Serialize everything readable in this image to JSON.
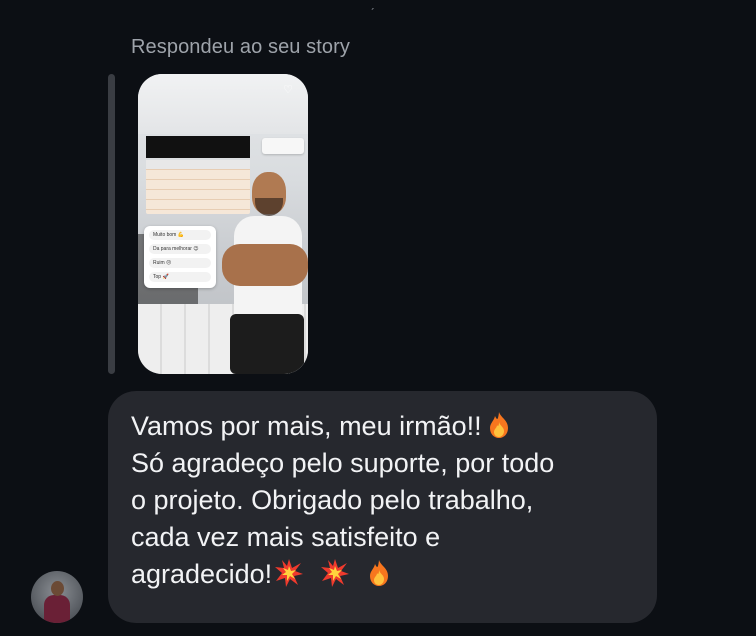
{
  "thread": {
    "reply_caption": "Respondeu ao seu story",
    "message": {
      "lines": [
        "Vamos por mais, meu irmão!!",
        "Só agradeço pelo suporte, por todo",
        "o projeto. Obrigado pelo trabalho,",
        "cada vez mais satisfeito e",
        "agradecido!"
      ],
      "line1_emoji": "fire-emoji",
      "line5_emojis": [
        "collision-emoji",
        "collision-emoji",
        "fire-emoji"
      ]
    },
    "story": {
      "poll_options": [
        "Muito bom 💪",
        "Da para melhorar 😉",
        "Ruim 😐",
        "Top 🚀"
      ]
    }
  }
}
